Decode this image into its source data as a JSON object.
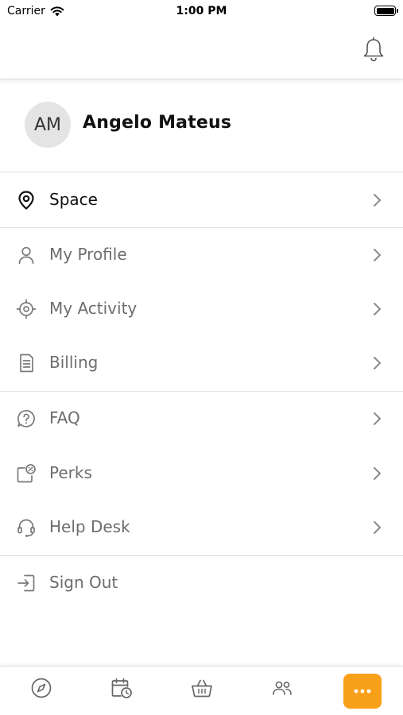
{
  "status_bar": {
    "carrier": "Carrier",
    "time": "1:00 PM"
  },
  "header": {
    "notification_icon": "bell-icon"
  },
  "profile": {
    "initials": "AM",
    "name": "Angelo Mateus"
  },
  "menu": {
    "items": [
      {
        "label": "Space",
        "icon": "location-pin-icon"
      },
      {
        "label": "My Profile",
        "icon": "user-icon"
      },
      {
        "label": "My Activity",
        "icon": "target-icon"
      },
      {
        "label": "Billing",
        "icon": "document-icon"
      },
      {
        "label": "FAQ",
        "icon": "question-bubble-icon"
      },
      {
        "label": "Perks",
        "icon": "discount-card-icon"
      },
      {
        "label": "Help Desk",
        "icon": "headset-icon"
      },
      {
        "label": "Sign Out",
        "icon": "sign-out-icon"
      }
    ]
  },
  "tab_bar": {
    "tabs": [
      {
        "icon": "compass-icon",
        "active": false
      },
      {
        "icon": "calendar-clock-icon",
        "active": false
      },
      {
        "icon": "basket-icon",
        "active": false
      },
      {
        "icon": "people-icon",
        "active": false
      },
      {
        "icon": "more-icon",
        "active": true
      }
    ]
  },
  "colors": {
    "accent": "#f9a01b",
    "muted_text": "#6d6d6d",
    "divider": "#e2e2e2"
  }
}
